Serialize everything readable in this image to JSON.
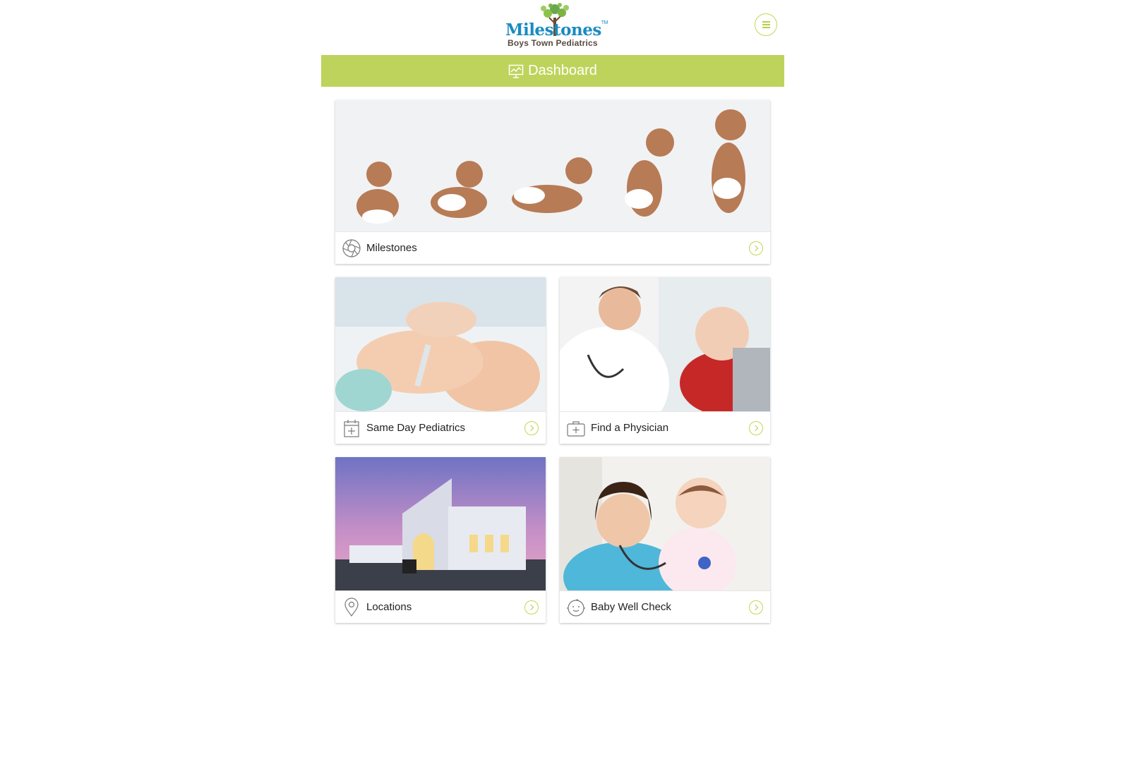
{
  "header": {
    "logo_word": "Milestones",
    "logo_tm": "TM",
    "logo_subtitle": "Boys Town Pediatrics",
    "menu_icon": "hamburger-menu-icon"
  },
  "dashboard": {
    "title": "Dashboard",
    "icon": "presentation-chart-icon"
  },
  "cards": [
    {
      "label": "Milestones",
      "icon": "milestones-swirl-icon"
    },
    {
      "label": "Same Day Pediatrics",
      "icon": "calendar-plus-icon"
    },
    {
      "label": "Find a Physician",
      "icon": "medical-bag-icon"
    },
    {
      "label": "Locations",
      "icon": "map-pin-icon"
    },
    {
      "label": "Baby Well Check",
      "icon": "baby-face-icon"
    }
  ],
  "colors": {
    "accent_green": "#bed35b",
    "logo_blue": "#1a8bc0",
    "logo_brown": "#5a4a3f"
  }
}
